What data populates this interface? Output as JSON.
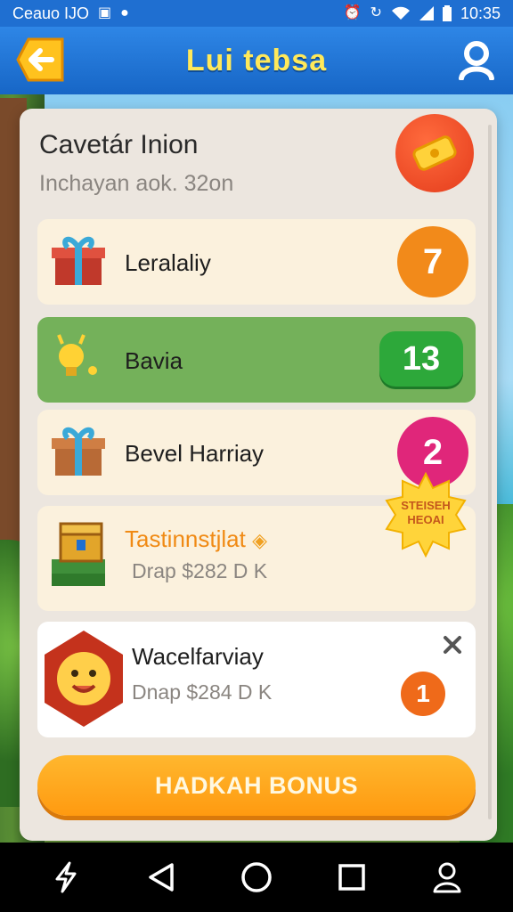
{
  "status_bar": {
    "carrier": "Ceauo IJO",
    "time": "10:35",
    "icons": [
      "notification-icon",
      "dot-icon",
      "alarm-icon",
      "sync-icon",
      "wifi-icon",
      "signal-icon",
      "battery-icon"
    ]
  },
  "app_bar": {
    "title": "Lui tebsa",
    "back_icon": "arrow-left-icon",
    "profile_icon": "user-icon"
  },
  "panel": {
    "title": "Cavetár Inion",
    "subtitle": "Inchayan aok. 32on",
    "header_icon": "ticket-icon",
    "items": [
      {
        "label": "Leralaliy",
        "badge": "7",
        "icon": "gift-box-icon",
        "badge_color": "#f28a1a"
      },
      {
        "label": "Bavia",
        "badge": "13",
        "icon": "bulb-mascot-icon",
        "badge_color": "#2da83a"
      },
      {
        "label": "Bevel Harriay",
        "badge": "2",
        "icon": "gift-box-blue-icon",
        "badge_color": "#e0267a"
      },
      {
        "label": "Tastinnstjlat",
        "sublabel": "Drap $282 D K",
        "icon": "treasure-chest-icon",
        "label_color": "#f08a14",
        "tag": "STEISEH\nHEOAI"
      },
      {
        "label": "Wacelfarviay",
        "sublabel": "Dnap $284 D K",
        "badge": "1",
        "icon": "smiley-sun-icon",
        "badge_color": "#ef6a1a",
        "close_icon": "close-icon"
      }
    ],
    "claim_button": "HADKAH BONUS"
  },
  "nav_bar": {
    "icons": [
      "bolt-icon",
      "back-triangle-icon",
      "home-circle-icon",
      "recents-square-icon",
      "person-outline-icon"
    ]
  }
}
